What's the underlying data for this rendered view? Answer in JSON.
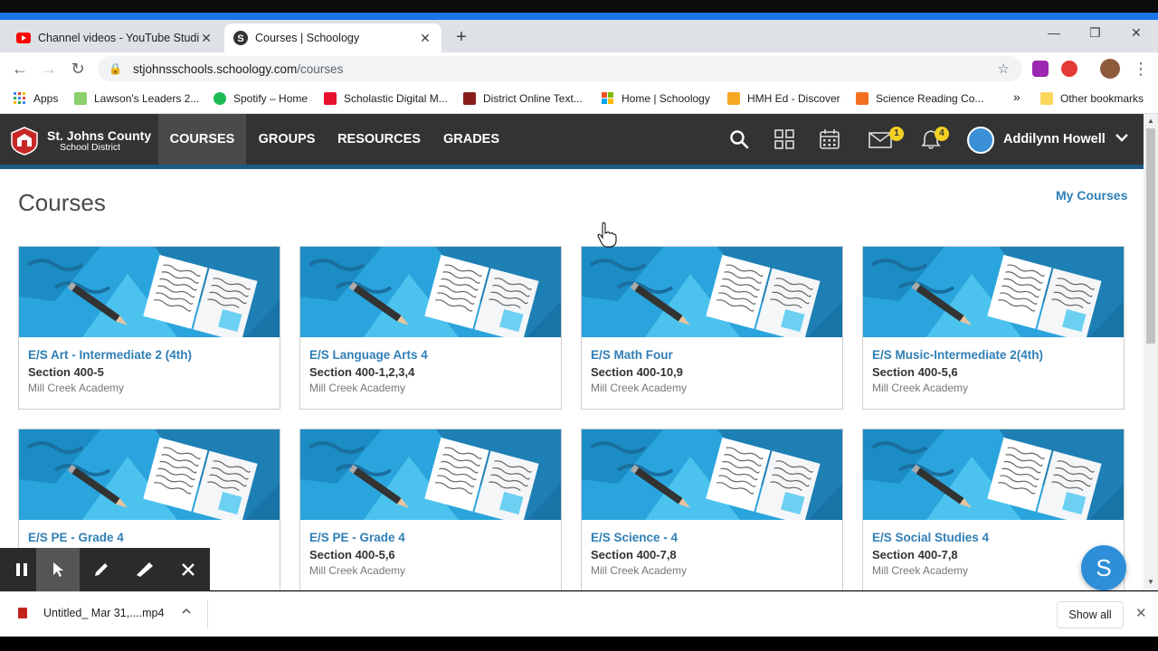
{
  "browser": {
    "tabs": [
      {
        "title": "Channel videos - YouTube Studio",
        "favicon": "youtube-icon",
        "active": false
      },
      {
        "title": "Courses | Schoology",
        "favicon": "schoology-icon",
        "active": true
      }
    ],
    "url_host": "stjohnsschools.schoology.com",
    "url_path": "/courses",
    "bookmarks": [
      {
        "label": "Apps",
        "icon": "apps-grid-icon",
        "color": "#4285f4"
      },
      {
        "label": "Lawson's Leaders 2...",
        "icon": "bookmark-icon",
        "color": "#8bd06b"
      },
      {
        "label": "Spotify – Home",
        "icon": "spotify-icon",
        "color": "#1db954"
      },
      {
        "label": "Scholastic Digital M...",
        "icon": "scholastic-icon",
        "color": "#e8112d"
      },
      {
        "label": "District Online Text...",
        "icon": "district-icon",
        "color": "#8a1c1c"
      },
      {
        "label": "Home | Schoology",
        "icon": "windows-icon",
        "color": "#f25022"
      },
      {
        "label": "HMH Ed - Discover",
        "icon": "hmh-icon",
        "color": "#f5a623"
      },
      {
        "label": "Science Reading Co...",
        "icon": "science-icon",
        "color": "#f37021"
      }
    ],
    "bookmarks_overflow": "»",
    "other_bookmarks": "Other bookmarks"
  },
  "header": {
    "logo_line1": "St. Johns County",
    "logo_line2": "School District",
    "nav": [
      {
        "label": "COURSES",
        "active": true
      },
      {
        "label": "GROUPS",
        "active": false
      },
      {
        "label": "RESOURCES",
        "active": false
      },
      {
        "label": "GRADES",
        "active": false
      }
    ],
    "messages_badge": "1",
    "notifications_badge": "4",
    "user_name": "Addilynn Howell"
  },
  "page": {
    "title": "Courses",
    "my_courses_link": "My Courses"
  },
  "courses": [
    {
      "name": "E/S Art - Intermediate 2 (4th)",
      "section": "Section 400-5",
      "school": "Mill Creek Academy"
    },
    {
      "name": "E/S Language Arts 4",
      "section": "Section 400-1,2,3,4",
      "school": "Mill Creek Academy"
    },
    {
      "name": "E/S Math Four",
      "section": "Section 400-10,9",
      "school": "Mill Creek Academy"
    },
    {
      "name": "E/S Music-Intermediate 2(4th)",
      "section": "Section 400-5,6",
      "school": "Mill Creek Academy"
    },
    {
      "name": "E/S PE - Grade 4",
      "section": "",
      "school": ""
    },
    {
      "name": "E/S PE - Grade 4",
      "section": "Section 400-5,6",
      "school": "Mill Creek Academy"
    },
    {
      "name": "E/S Science - 4",
      "section": "Section 400-7,8",
      "school": "Mill Creek Academy"
    },
    {
      "name": "E/S Social Studies 4",
      "section": "Section 400-7,8",
      "school": "Mill Creek Academy"
    }
  ],
  "chat_bubble": "S",
  "downloads": {
    "file": "Untitled_ Mar 31,....mp4",
    "show_all": "Show all"
  },
  "colors": {
    "accent": "#2f7fb6",
    "header": "#333333",
    "card_image": "#2aa4dc"
  }
}
